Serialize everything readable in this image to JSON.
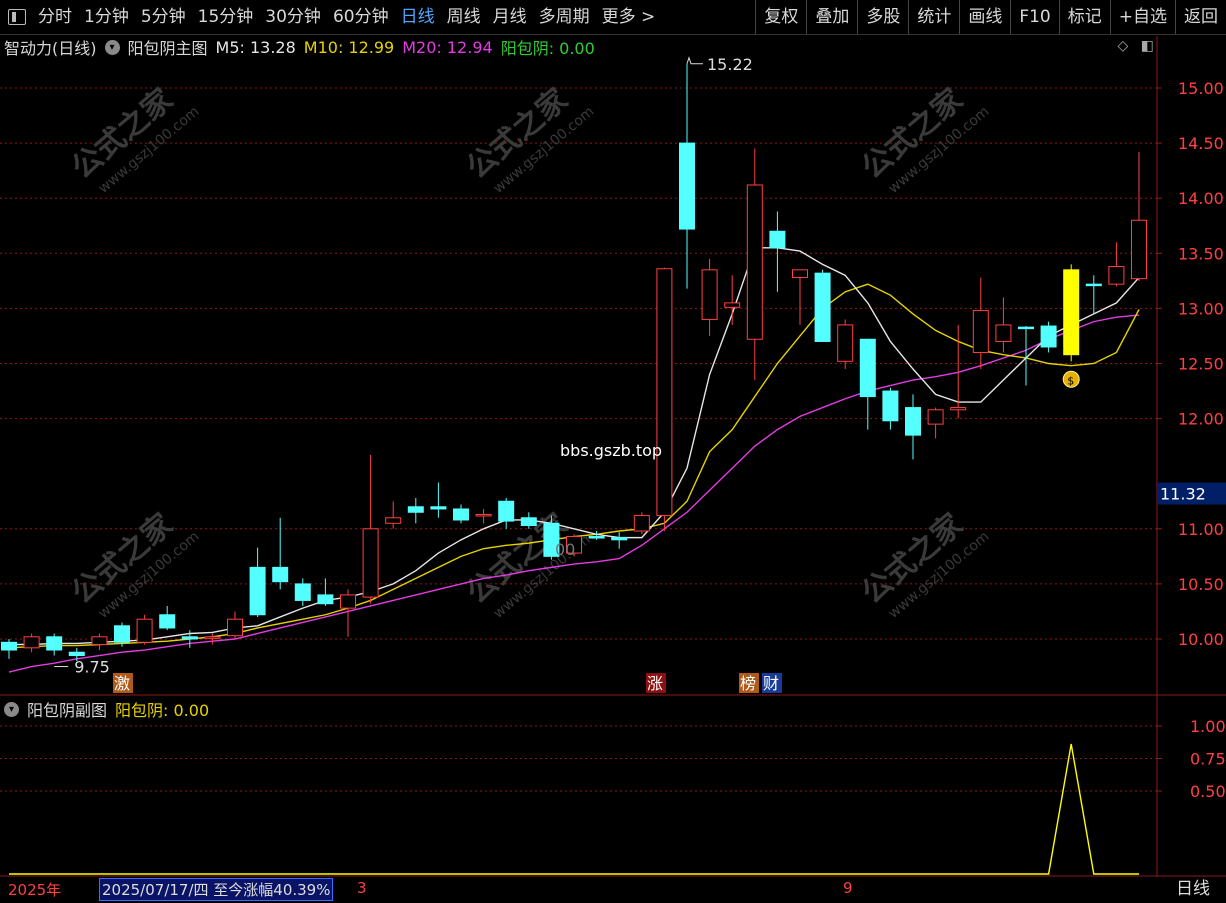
{
  "toolbar": {
    "left_items": [
      "分时",
      "1分钟",
      "5分钟",
      "15分钟",
      "30分钟",
      "60分钟",
      "日线",
      "周线",
      "月线",
      "多周期",
      "更多 >"
    ],
    "active": "日线",
    "right_items": [
      "复权",
      "叠加",
      "多股",
      "统计",
      "画线",
      "F10",
      "标记",
      "+自选",
      "返回"
    ]
  },
  "header": {
    "indicator": "智动力(日线)",
    "formula": "阳包阴主图",
    "m5": "M5: 13.28",
    "m10": "M10: 12.99",
    "m20": "M20: 12.94",
    "ybys": "阳包阴: 0.00"
  },
  "sub_header": {
    "formula": "阳包阴副图",
    "value": "阳包阴: 0.00"
  },
  "watermark": {
    "text": "公式之家",
    "url": "www.gszj100.com",
    "site": "bbs.gszb.top"
  },
  "annotations": {
    "high_label": "15.22",
    "low_label": "9.75",
    "current_price": "11.32",
    "tag1": "激",
    "tag2": "涨",
    "tag3": "榜",
    "tag4": "财",
    "partial_text": "00"
  },
  "date_bar": {
    "year": "2025年",
    "info": "2025/07/17/四  至今涨幅40.39%",
    "info_suffix": "3",
    "month_mark": "9"
  },
  "period_label": "日线",
  "colors": {
    "up": "#ff4040",
    "down": "#54ffff",
    "m5": "#e6e6e6",
    "m10": "#e6d200",
    "m20": "#e23ce2",
    "grid": "#8b1a1a",
    "signal": "#ffff00"
  },
  "chart_data": {
    "type": "candlestick",
    "price_axis": {
      "ticks": [
        "15.00",
        "14.50",
        "14.00",
        "13.50",
        "13.00",
        "12.50",
        "12.00",
        "11.00",
        "10.50",
        "10.00"
      ]
    },
    "sub_axis": {
      "ticks": [
        "1.00",
        "0.75",
        "0.50"
      ]
    },
    "candles": [
      {
        "o": 9.97,
        "h": 10.0,
        "l": 9.82,
        "c": 9.9
      },
      {
        "o": 9.92,
        "h": 10.05,
        "l": 9.88,
        "c": 10.02
      },
      {
        "o": 10.02,
        "h": 10.05,
        "l": 9.85,
        "c": 9.9
      },
      {
        "o": 9.88,
        "h": 9.92,
        "l": 9.8,
        "c": 9.85
      },
      {
        "o": 9.95,
        "h": 10.05,
        "l": 9.9,
        "c": 10.02
      },
      {
        "o": 10.12,
        "h": 10.15,
        "l": 9.93,
        "c": 9.97
      },
      {
        "o": 9.97,
        "h": 10.22,
        "l": 9.95,
        "c": 10.18
      },
      {
        "o": 10.22,
        "h": 10.3,
        "l": 10.08,
        "c": 10.1
      },
      {
        "o": 10.02,
        "h": 10.08,
        "l": 9.92,
        "c": 10.0
      },
      {
        "o": 10.02,
        "h": 10.05,
        "l": 9.95,
        "c": 10.02
      },
      {
        "o": 10.03,
        "h": 10.25,
        "l": 10.0,
        "c": 10.18
      },
      {
        "o": 10.65,
        "h": 10.83,
        "l": 10.2,
        "c": 10.22
      },
      {
        "o": 10.65,
        "h": 11.1,
        "l": 10.45,
        "c": 10.52
      },
      {
        "o": 10.5,
        "h": 10.55,
        "l": 10.3,
        "c": 10.35
      },
      {
        "o": 10.4,
        "h": 10.55,
        "l": 10.3,
        "c": 10.32
      },
      {
        "o": 10.28,
        "h": 10.45,
        "l": 10.02,
        "c": 10.4
      },
      {
        "o": 10.38,
        "h": 11.67,
        "l": 10.32,
        "c": 11.0
      },
      {
        "o": 11.05,
        "h": 11.25,
        "l": 11.0,
        "c": 11.1
      },
      {
        "o": 11.2,
        "h": 11.28,
        "l": 11.05,
        "c": 11.15
      },
      {
        "o": 11.2,
        "h": 11.42,
        "l": 11.1,
        "c": 11.18
      },
      {
        "o": 11.18,
        "h": 11.22,
        "l": 11.05,
        "c": 11.08
      },
      {
        "o": 11.12,
        "h": 11.18,
        "l": 11.05,
        "c": 11.13
      },
      {
        "o": 11.25,
        "h": 11.28,
        "l": 11.0,
        "c": 11.07
      },
      {
        "o": 11.1,
        "h": 11.15,
        "l": 11.0,
        "c": 11.03
      },
      {
        "o": 11.05,
        "h": 11.12,
        "l": 10.72,
        "c": 10.75
      },
      {
        "o": 10.78,
        "h": 10.95,
        "l": 10.75,
        "c": 10.93
      },
      {
        "o": 10.93,
        "h": 10.98,
        "l": 10.9,
        "c": 10.92
      },
      {
        "o": 10.92,
        "h": 10.97,
        "l": 10.82,
        "c": 10.9
      },
      {
        "o": 10.98,
        "h": 11.15,
        "l": 10.95,
        "c": 11.12
      },
      {
        "o": 11.12,
        "h": 13.37,
        "l": 10.98,
        "c": 13.36
      },
      {
        "o": 14.5,
        "h": 15.22,
        "l": 13.18,
        "c": 13.72
      },
      {
        "o": 12.9,
        "h": 13.45,
        "l": 12.75,
        "c": 13.35
      },
      {
        "o": 13.01,
        "h": 13.3,
        "l": 12.85,
        "c": 13.05
      },
      {
        "o": 12.72,
        "h": 14.45,
        "l": 12.35,
        "c": 14.12
      },
      {
        "o": 13.7,
        "h": 13.88,
        "l": 13.15,
        "c": 13.55
      },
      {
        "o": 13.28,
        "h": 13.35,
        "l": 12.85,
        "c": 13.35
      },
      {
        "o": 13.32,
        "h": 13.35,
        "l": 12.7,
        "c": 12.7
      },
      {
        "o": 12.52,
        "h": 12.9,
        "l": 12.45,
        "c": 12.85
      },
      {
        "o": 12.72,
        "h": 12.72,
        "l": 11.9,
        "c": 12.2
      },
      {
        "o": 12.25,
        "h": 12.28,
        "l": 11.9,
        "c": 11.98
      },
      {
        "o": 12.1,
        "h": 12.22,
        "l": 11.63,
        "c": 11.85
      },
      {
        "o": 11.95,
        "h": 12.1,
        "l": 11.82,
        "c": 12.08
      },
      {
        "o": 12.08,
        "h": 12.85,
        "l": 12.0,
        "c": 12.1
      },
      {
        "o": 12.6,
        "h": 13.28,
        "l": 12.45,
        "c": 12.98
      },
      {
        "o": 12.7,
        "h": 13.1,
        "l": 12.6,
        "c": 12.85
      },
      {
        "o": 12.83,
        "h": 12.84,
        "l": 12.3,
        "c": 12.82
      },
      {
        "o": 12.84,
        "h": 12.88,
        "l": 12.6,
        "c": 12.65
      },
      {
        "o": 12.58,
        "h": 13.4,
        "l": 12.52,
        "c": 13.35
      },
      {
        "o": 13.22,
        "h": 13.3,
        "l": 12.95,
        "c": 13.21
      },
      {
        "o": 13.22,
        "h": 13.6,
        "l": 13.2,
        "c": 13.38
      },
      {
        "o": 13.27,
        "h": 14.42,
        "l": 13.25,
        "c": 13.8
      }
    ],
    "m5": [
      9.95,
      9.95,
      9.96,
      9.96,
      9.97,
      9.98,
      9.99,
      10.02,
      10.05,
      10.06,
      10.1,
      10.12,
      10.2,
      10.28,
      10.35,
      10.38,
      10.43,
      10.5,
      10.62,
      10.78,
      10.9,
      11.0,
      11.08,
      11.08,
      11.05,
      11.0,
      10.95,
      10.92,
      10.92,
      11.15,
      11.55,
      12.4,
      12.95,
      13.55,
      13.55,
      13.52,
      13.4,
      13.3,
      13.05,
      12.7,
      12.45,
      12.22,
      12.15,
      12.15,
      12.35,
      12.55,
      12.75,
      12.85,
      12.95,
      13.05,
      13.28
    ],
    "m10": [
      9.92,
      9.93,
      9.94,
      9.94,
      9.95,
      9.96,
      9.97,
      9.98,
      10.0,
      10.02,
      10.05,
      10.1,
      10.14,
      10.18,
      10.22,
      10.28,
      10.35,
      10.45,
      10.55,
      10.65,
      10.75,
      10.82,
      10.85,
      10.87,
      10.9,
      10.93,
      10.95,
      10.98,
      11.0,
      11.05,
      11.25,
      11.7,
      11.9,
      12.2,
      12.5,
      12.75,
      13.0,
      13.15,
      13.22,
      13.12,
      12.95,
      12.8,
      12.7,
      12.62,
      12.58,
      12.55,
      12.5,
      12.48,
      12.5,
      12.6,
      12.99
    ],
    "m20": [
      9.7,
      9.75,
      9.78,
      9.82,
      9.85,
      9.88,
      9.9,
      9.93,
      9.96,
      9.98,
      10.0,
      10.05,
      10.1,
      10.15,
      10.2,
      10.25,
      10.3,
      10.35,
      10.4,
      10.45,
      10.5,
      10.55,
      10.58,
      10.62,
      10.65,
      10.68,
      10.7,
      10.73,
      10.85,
      11.0,
      11.15,
      11.35,
      11.55,
      11.75,
      11.9,
      12.02,
      12.1,
      12.18,
      12.25,
      12.3,
      12.35,
      12.38,
      12.42,
      12.48,
      12.55,
      12.62,
      12.72,
      12.8,
      12.88,
      12.92,
      12.94
    ],
    "signal": [
      0,
      0,
      0,
      0,
      0,
      0,
      0,
      0,
      0,
      0,
      0,
      0,
      0,
      0,
      0,
      0,
      0,
      0,
      0,
      0,
      0,
      0,
      0,
      0,
      0,
      0,
      0,
      0,
      0,
      0,
      0,
      0,
      0,
      0,
      0,
      0,
      0,
      0,
      0,
      0,
      0,
      0,
      0,
      0,
      0,
      0,
      0,
      1,
      0,
      0,
      0
    ]
  }
}
